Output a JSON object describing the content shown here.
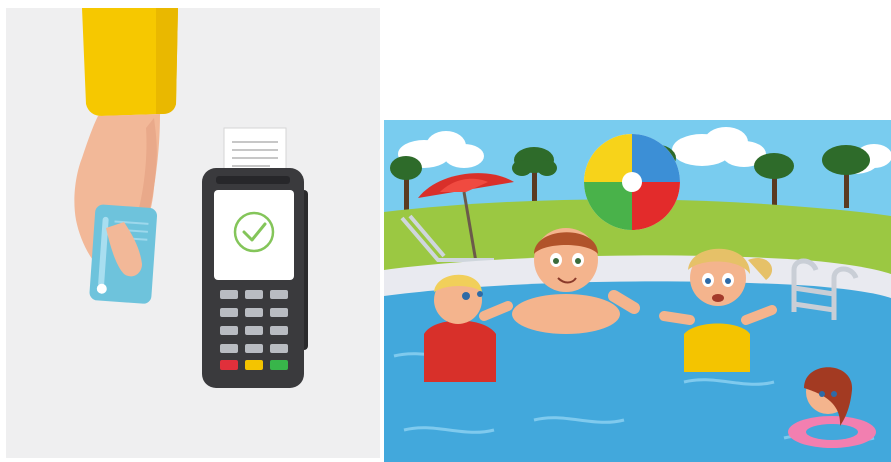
{
  "payment_illustration": {
    "background": "#efeff0",
    "sleeve_color": "#f6c800",
    "skin_color": "#f2b898",
    "card_color": "#6ec3dc",
    "terminal_body_color": "#3a3a3d",
    "screen_color": "#ffffff",
    "checkmark_color": "#84c55a",
    "key_colors": {
      "cancel": "#e0303b",
      "clear": "#f4c400",
      "confirm": "#38b54a",
      "number": "#b9bcc2"
    },
    "screen_status_icon": "checkmark-icon",
    "receipt": "paper-receipt"
  },
  "pool_illustration": {
    "sky_color": "#79ccef",
    "grass_color": "#9bc842",
    "water_color": "#42a8dc",
    "pool_edge_color": "#e9eaf0",
    "umbrella_color": "#d9302a",
    "beach_ball_colors": [
      "#e32b2b",
      "#f7d31a",
      "#3c8fd6",
      "#49b24a",
      "#ffffff"
    ],
    "ring_color": "#f27fb0",
    "characters": [
      "boy-red-shirt",
      "boy-center",
      "girl-blonde",
      "girl-swim-ring"
    ],
    "objects": [
      "beach-umbrella",
      "lounge-chair",
      "beach-ball",
      "pool-ladder",
      "trees",
      "clouds"
    ]
  }
}
